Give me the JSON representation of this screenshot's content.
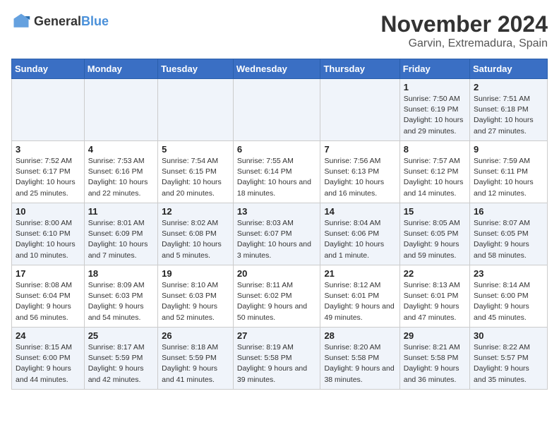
{
  "logo": {
    "general": "General",
    "blue": "Blue"
  },
  "title": {
    "month": "November 2024",
    "location": "Garvin, Extremadura, Spain"
  },
  "weekdays": [
    "Sunday",
    "Monday",
    "Tuesday",
    "Wednesday",
    "Thursday",
    "Friday",
    "Saturday"
  ],
  "weeks": [
    [
      {
        "day": "",
        "info": ""
      },
      {
        "day": "",
        "info": ""
      },
      {
        "day": "",
        "info": ""
      },
      {
        "day": "",
        "info": ""
      },
      {
        "day": "",
        "info": ""
      },
      {
        "day": "1",
        "info": "Sunrise: 7:50 AM\nSunset: 6:19 PM\nDaylight: 10 hours and 29 minutes."
      },
      {
        "day": "2",
        "info": "Sunrise: 7:51 AM\nSunset: 6:18 PM\nDaylight: 10 hours and 27 minutes."
      }
    ],
    [
      {
        "day": "3",
        "info": "Sunrise: 7:52 AM\nSunset: 6:17 PM\nDaylight: 10 hours and 25 minutes."
      },
      {
        "day": "4",
        "info": "Sunrise: 7:53 AM\nSunset: 6:16 PM\nDaylight: 10 hours and 22 minutes."
      },
      {
        "day": "5",
        "info": "Sunrise: 7:54 AM\nSunset: 6:15 PM\nDaylight: 10 hours and 20 minutes."
      },
      {
        "day": "6",
        "info": "Sunrise: 7:55 AM\nSunset: 6:14 PM\nDaylight: 10 hours and 18 minutes."
      },
      {
        "day": "7",
        "info": "Sunrise: 7:56 AM\nSunset: 6:13 PM\nDaylight: 10 hours and 16 minutes."
      },
      {
        "day": "8",
        "info": "Sunrise: 7:57 AM\nSunset: 6:12 PM\nDaylight: 10 hours and 14 minutes."
      },
      {
        "day": "9",
        "info": "Sunrise: 7:59 AM\nSunset: 6:11 PM\nDaylight: 10 hours and 12 minutes."
      }
    ],
    [
      {
        "day": "10",
        "info": "Sunrise: 8:00 AM\nSunset: 6:10 PM\nDaylight: 10 hours and 10 minutes."
      },
      {
        "day": "11",
        "info": "Sunrise: 8:01 AM\nSunset: 6:09 PM\nDaylight: 10 hours and 7 minutes."
      },
      {
        "day": "12",
        "info": "Sunrise: 8:02 AM\nSunset: 6:08 PM\nDaylight: 10 hours and 5 minutes."
      },
      {
        "day": "13",
        "info": "Sunrise: 8:03 AM\nSunset: 6:07 PM\nDaylight: 10 hours and 3 minutes."
      },
      {
        "day": "14",
        "info": "Sunrise: 8:04 AM\nSunset: 6:06 PM\nDaylight: 10 hours and 1 minute."
      },
      {
        "day": "15",
        "info": "Sunrise: 8:05 AM\nSunset: 6:05 PM\nDaylight: 9 hours and 59 minutes."
      },
      {
        "day": "16",
        "info": "Sunrise: 8:07 AM\nSunset: 6:05 PM\nDaylight: 9 hours and 58 minutes."
      }
    ],
    [
      {
        "day": "17",
        "info": "Sunrise: 8:08 AM\nSunset: 6:04 PM\nDaylight: 9 hours and 56 minutes."
      },
      {
        "day": "18",
        "info": "Sunrise: 8:09 AM\nSunset: 6:03 PM\nDaylight: 9 hours and 54 minutes."
      },
      {
        "day": "19",
        "info": "Sunrise: 8:10 AM\nSunset: 6:03 PM\nDaylight: 9 hours and 52 minutes."
      },
      {
        "day": "20",
        "info": "Sunrise: 8:11 AM\nSunset: 6:02 PM\nDaylight: 9 hours and 50 minutes."
      },
      {
        "day": "21",
        "info": "Sunrise: 8:12 AM\nSunset: 6:01 PM\nDaylight: 9 hours and 49 minutes."
      },
      {
        "day": "22",
        "info": "Sunrise: 8:13 AM\nSunset: 6:01 PM\nDaylight: 9 hours and 47 minutes."
      },
      {
        "day": "23",
        "info": "Sunrise: 8:14 AM\nSunset: 6:00 PM\nDaylight: 9 hours and 45 minutes."
      }
    ],
    [
      {
        "day": "24",
        "info": "Sunrise: 8:15 AM\nSunset: 6:00 PM\nDaylight: 9 hours and 44 minutes."
      },
      {
        "day": "25",
        "info": "Sunrise: 8:17 AM\nSunset: 5:59 PM\nDaylight: 9 hours and 42 minutes."
      },
      {
        "day": "26",
        "info": "Sunrise: 8:18 AM\nSunset: 5:59 PM\nDaylight: 9 hours and 41 minutes."
      },
      {
        "day": "27",
        "info": "Sunrise: 8:19 AM\nSunset: 5:58 PM\nDaylight: 9 hours and 39 minutes."
      },
      {
        "day": "28",
        "info": "Sunrise: 8:20 AM\nSunset: 5:58 PM\nDaylight: 9 hours and 38 minutes."
      },
      {
        "day": "29",
        "info": "Sunrise: 8:21 AM\nSunset: 5:58 PM\nDaylight: 9 hours and 36 minutes."
      },
      {
        "day": "30",
        "info": "Sunrise: 8:22 AM\nSunset: 5:57 PM\nDaylight: 9 hours and 35 minutes."
      }
    ]
  ]
}
